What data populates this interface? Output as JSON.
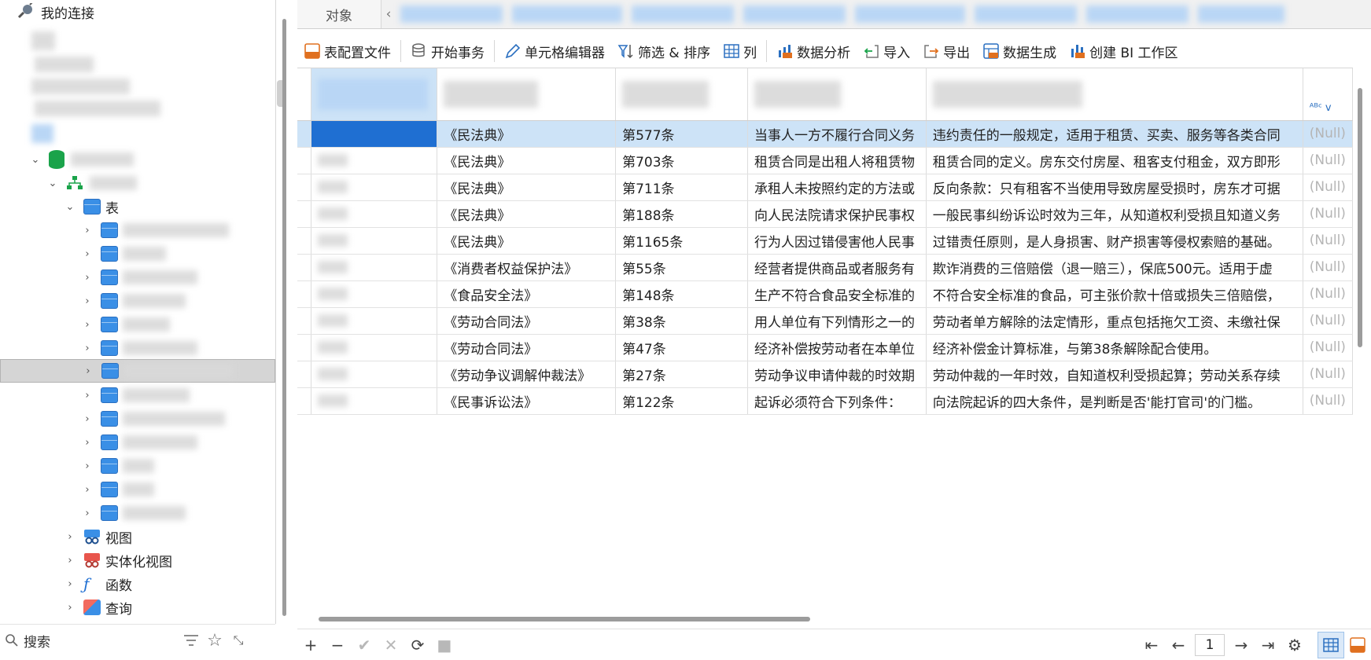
{
  "nav": {
    "connections_label": "我的连接",
    "tables_label": "表",
    "views_label": "视图",
    "materialized_views_label": "实体化视图",
    "functions_label": "函数",
    "queries_label": "查询",
    "search_placeholder": "搜索"
  },
  "tabs": {
    "object_label": "对象"
  },
  "toolbar": {
    "table_config": "表配置文件",
    "begin_transaction": "开始事务",
    "cell_editor": "单元格编辑器",
    "filter_sort": "筛选 & 排序",
    "columns": "列",
    "data_analysis": "数据分析",
    "import": "导入",
    "export": "导出",
    "data_generation": "数据生成",
    "create_bi": "创建 BI 工作区"
  },
  "grid": {
    "null_text": "(Null)",
    "rows": [
      {
        "law": "《民法典》",
        "article": "第577条",
        "content": "当事人一方不履行合同义务",
        "note": "违约责任的一般规定，适用于租赁、买卖、服务等各类合同"
      },
      {
        "law": "《民法典》",
        "article": "第703条",
        "content": "租赁合同是出租人将租赁物",
        "note": "租赁合同的定义。房东交付房屋、租客支付租金，双方即形"
      },
      {
        "law": "《民法典》",
        "article": "第711条",
        "content": "承租人未按照约定的方法或",
        "note": "反向条款：只有租客不当使用导致房屋受损时，房东才可据"
      },
      {
        "law": "《民法典》",
        "article": "第188条",
        "content": "向人民法院请求保护民事权",
        "note": "一般民事纠纷诉讼时效为三年，从知道权利受损且知道义务"
      },
      {
        "law": "《民法典》",
        "article": "第1165条",
        "content": "行为人因过错侵害他人民事",
        "note": "过错责任原则，是人身损害、财产损害等侵权索赔的基础。"
      },
      {
        "law": "《消费者权益保护法》",
        "article": "第55条",
        "content": "经营者提供商品或者服务有",
        "note": "欺诈消费的三倍赔偿（退一赔三），保底500元。适用于虚"
      },
      {
        "law": "《食品安全法》",
        "article": "第148条",
        "content": "生产不符合食品安全标准的",
        "note": "不符合安全标准的食品，可主张价款十倍或损失三倍赔偿，"
      },
      {
        "law": "《劳动合同法》",
        "article": "第38条",
        "content": "用人单位有下列情形之一的",
        "note": "劳动者单方解除的法定情形，重点包括拖欠工资、未缴社保"
      },
      {
        "law": "《劳动合同法》",
        "article": "第47条",
        "content": "经济补偿按劳动者在本单位",
        "note": "经济补偿金计算标准，与第38条解除配合使用。"
      },
      {
        "law": "《劳动争议调解仲裁法》",
        "article": "第27条",
        "content": "劳动争议申请仲裁的时效期",
        "note": "劳动仲裁的一年时效，自知道权利受损起算；劳动关系存续"
      },
      {
        "law": "《民事诉讼法》",
        "article": "第122条",
        "content": "起诉必须符合下列条件：",
        "note": "向法院起诉的四大条件，是判断是否'能打官司'的门槛。"
      }
    ]
  },
  "pager": {
    "page": "1"
  },
  "colors": {
    "accent": "#1f6fd2",
    "selection": "#cde3f7",
    "tree_selected": "#d5d5d5"
  }
}
